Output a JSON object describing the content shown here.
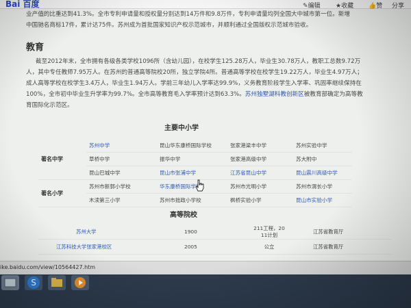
{
  "browser": {
    "logo": "Bai 百度",
    "toolbar": {
      "edit": "编辑",
      "favorite": "收藏",
      "like": "赞",
      "share": "分享"
    }
  },
  "article": {
    "intro_line1": "业产值的比重达到41.3%。全市专利申请量和授权量分别达到14万件和9.8万件，专利申请量均列全国大中城市第一位。新增",
    "intro_line2": "中国驰名商标17件，累计达75件。苏州成为首批国家知识产权示范城市，并顺利通过全国版权示范城市验收。",
    "section_title": "教育",
    "edu_line1": "截至2012年末，全市拥有各级各类学校1096所（含幼儿园），在校学生125.28万人，毕业生30.78万人，教职工总数9.72万",
    "edu_line2": "人，其中专任教师7.95万人。在苏州的普通高等院校20所，独立学院4所。普通高等学校在校学生19.22万人，毕业生4.97万人；",
    "edu_line3": "成人高等学校在校学生3.4万人，毕业生1.94万人。学前三年幼儿入学率达99.9%，义务教育阶段学生入学率、巩固率继续保持在",
    "edu_line4_pre": "100%，全市初中毕业生升学率为99.7%。全市高等教育毛入学率预计达到63.3%。",
    "edu_line4_link": "苏州独墅湖科教创新区",
    "edu_line4_post": "被教育部确定为高等教",
    "edu_line5": "育国际化示范区。"
  },
  "schools": {
    "title": "主要中小学",
    "middle_label": "著名中学",
    "primary_label": "著名小学",
    "rows": [
      [
        "苏州中学",
        "昆山华东康桥国际学校",
        "张家港梁丰中学",
        "苏州实验中学"
      ],
      [
        "草桥中学",
        "振华中学",
        "张家港高级中学",
        "苏大附中"
      ],
      [
        "昆山巴城中学",
        "昆山市张浦中学",
        "江苏省昆山中学",
        "昆山震川高级中学"
      ],
      [
        "苏州市新郭小学校",
        "华东康桥国际学校",
        "苏州市光明小学",
        "苏州市渭长小学"
      ],
      [
        "木渎第三小学",
        "苏州市拙政小学校",
        "枫桥实验小学",
        "昆山市实验小学"
      ]
    ]
  },
  "universities": {
    "title": "高等院校",
    "rows": [
      {
        "name": "苏州大学",
        "year": "1900",
        "type_line1": "211工程，20",
        "type_line2": "11计划",
        "authority": "江苏省教育厅"
      },
      {
        "name": "江苏科技大学张家港校区",
        "year": "2005",
        "type_line1": "公立",
        "type_line2": "",
        "authority": "江苏省教育厅"
      }
    ]
  },
  "statusbar": {
    "url": "ike.baidu.com/view/10564427.htm"
  },
  "colors": {
    "link": "#2f58b7",
    "text": "#4a4a4a",
    "background": "#eef0ee",
    "taskbar": "#2d3b4d"
  }
}
